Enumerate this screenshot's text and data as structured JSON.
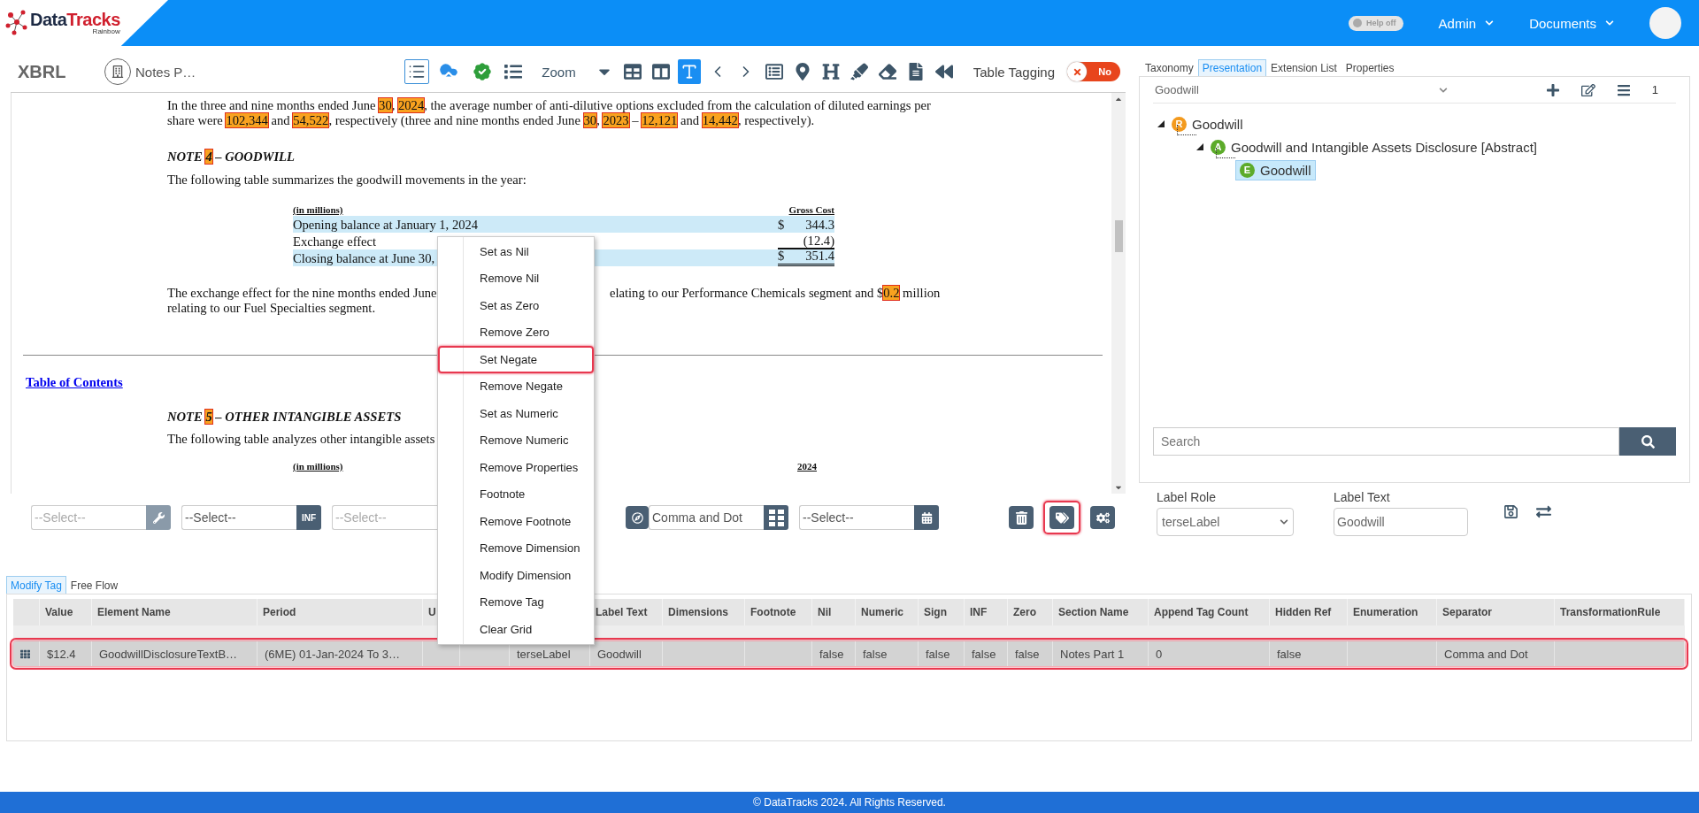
{
  "header": {
    "logo": {
      "brand_first": "Data",
      "brand_second": "Tracks",
      "tagline": "Rainbow"
    },
    "help_toggle": {
      "label": "Help off",
      "on": false
    },
    "menus": [
      {
        "label": "Admin"
      },
      {
        "label": "Documents"
      }
    ]
  },
  "toolbar": {
    "title": "XBRL",
    "section": "Notes P…",
    "tools": [
      {
        "kind": "panel",
        "selected": false
      },
      {
        "kind": "upload",
        "selected": false
      },
      {
        "kind": "verify",
        "selected": false
      },
      {
        "kind": "list",
        "selected": false
      },
      {
        "kind": "zoom",
        "label": "Zoom",
        "selected": false
      },
      {
        "kind": "caret",
        "selected": false
      },
      {
        "kind": "table",
        "selected": false
      },
      {
        "kind": "columns",
        "selected": false
      },
      {
        "kind": "text",
        "selected": true
      },
      {
        "kind": "prev",
        "selected": false
      },
      {
        "kind": "next",
        "selected": false
      },
      {
        "kind": "card",
        "selected": false
      },
      {
        "kind": "pin",
        "selected": false
      },
      {
        "kind": "heading",
        "selected": false
      },
      {
        "kind": "highlight",
        "selected": false
      },
      {
        "kind": "erase",
        "selected": false
      },
      {
        "kind": "file",
        "selected": false
      },
      {
        "kind": "back",
        "selected": false
      }
    ],
    "table_tagging": {
      "label": "Table Tagging",
      "toggle_label": "No",
      "on": false
    }
  },
  "document": {
    "paragraph_1": [
      {
        "text": "In the three and nine months ended June ",
        "tagged": false
      },
      {
        "text": "30",
        "tagged": true
      },
      {
        "text": ", ",
        "tagged": false
      },
      {
        "text": "2024",
        "tagged": true
      },
      {
        "text": ", the average number of anti-dilutive options excluded from the calculation of diluted earnings per share were ",
        "tagged": false
      },
      {
        "text": "102,344",
        "tagged": true
      },
      {
        "text": " and ",
        "tagged": false
      },
      {
        "text": "54,522",
        "tagged": true
      },
      {
        "text": ", respectively (three and nine months ended June ",
        "tagged": false
      },
      {
        "text": "30",
        "tagged": true
      },
      {
        "text": ", ",
        "tagged": false
      },
      {
        "text": "2023",
        "tagged": true
      },
      {
        "text": " – ",
        "tagged": false
      },
      {
        "text": "12,121",
        "tagged": true
      },
      {
        "text": " and ",
        "tagged": false
      },
      {
        "text": "14,442",
        "tagged": true
      },
      {
        "text": ", respectively).",
        "tagged": false
      }
    ],
    "note_4_heading": [
      {
        "text": "NOTE ",
        "tagged": false
      },
      {
        "text": "4",
        "tagged": true
      },
      {
        "text": " – GOODWILL",
        "tagged": false
      }
    ],
    "note_4_intro": "The following table summarizes the goodwill movements in the year:",
    "goodwill_table": {
      "unit_header": "(in millions)",
      "value_header": "Gross Cost",
      "rows": [
        {
          "label": "Opening balance at January 1, 2024",
          "currency": "$",
          "value": "344.3",
          "shaded": true,
          "kind": "plain"
        },
        {
          "label": "Exchange effect",
          "value": "(12.4)",
          "shaded": false,
          "kind": "subtotal"
        },
        {
          "label": "Closing balance at June 30,",
          "currency": "$",
          "value": "351.4",
          "shaded": true,
          "kind": "total"
        }
      ]
    },
    "exchange_paragraph": {
      "left": "The exchange effect for the nine months ended June",
      "right": [
        {
          "text": "elating to our Performance Chemicals segment and $",
          "tagged": false
        },
        {
          "text": "0.2",
          "tagged": true
        },
        {
          "text": " million",
          "tagged": false
        }
      ],
      "continuation": "relating to our Fuel Specialties segment."
    },
    "toc_link": "Table of Contents",
    "note_5_heading": [
      {
        "text": "NOTE ",
        "tagged": false
      },
      {
        "text": "5",
        "tagged": true
      },
      {
        "text": " – OTHER INTANGIBLE ASSETS",
        "tagged": false
      }
    ],
    "note_5_intro": "The following table analyzes other intangible assets",
    "next_table": {
      "unit_header": "(in millions)",
      "value_header": "2024"
    }
  },
  "context_menu": {
    "items": [
      {
        "label": "Set as Nil",
        "highlighted": false
      },
      {
        "label": "Remove Nil",
        "highlighted": false
      },
      {
        "label": "Set as Zero",
        "highlighted": false
      },
      {
        "label": "Remove Zero",
        "highlighted": false
      },
      {
        "label": "Set Negate",
        "highlighted": true
      },
      {
        "label": "Remove Negate",
        "highlighted": false
      },
      {
        "label": "Set as Numeric",
        "highlighted": false
      },
      {
        "label": "Remove Numeric",
        "highlighted": false
      },
      {
        "label": "Remove Properties",
        "highlighted": false
      },
      {
        "label": "Footnote",
        "highlighted": false
      },
      {
        "label": "Remove Footnote",
        "highlighted": false
      },
      {
        "label": "Remove Dimension",
        "highlighted": false
      },
      {
        "label": "Modify Dimension",
        "highlighted": false
      },
      {
        "label": "Remove Tag",
        "highlighted": false
      },
      {
        "label": "Clear Grid",
        "highlighted": false
      }
    ]
  },
  "controls": {
    "fields": [
      {
        "placeholder": "--Select--",
        "disabled": true,
        "button": {
          "kind": "wrench"
        }
      },
      {
        "placeholder": "--Select--",
        "disabled": false,
        "button": {
          "kind": "inf",
          "label": "INF"
        }
      },
      {
        "placeholder": "--Select--",
        "disabled": true,
        "button": {
          "kind": "compass"
        }
      },
      {
        "value": "Comma and Dot",
        "disabled": false,
        "button": {
          "kind": "grid"
        }
      },
      {
        "placeholder": "--Select--",
        "disabled": false,
        "button": {
          "kind": "calendar"
        }
      }
    ],
    "actions": [
      {
        "kind": "delete",
        "highlighted": false
      },
      {
        "kind": "tag",
        "highlighted": true
      },
      {
        "kind": "settings",
        "highlighted": false
      }
    ]
  },
  "right_panel": {
    "tabs": [
      {
        "label": "Taxonomy",
        "selected": false
      },
      {
        "label": "Presentation",
        "selected": true
      },
      {
        "label": "Extension List",
        "selected": false
      },
      {
        "label": "Properties",
        "selected": false
      }
    ],
    "dropdown": "Goodwill",
    "count": "1",
    "tree": [
      {
        "badge": "R",
        "label": "Goodwill",
        "color": "#f39a1e",
        "selected": false,
        "children": [
          {
            "badge": "A",
            "label": "Goodwill and Intangible Assets Disclosure [Abstract]",
            "color": "#5cab2a",
            "selected": false,
            "children": [
              {
                "badge": "E",
                "label": "Goodwill",
                "color": "#5cab2a",
                "selected": true
              }
            ]
          }
        ]
      }
    ],
    "search_placeholder": "Search",
    "label_role": {
      "label": "Label Role",
      "value": "terseLabel"
    },
    "label_text": {
      "label": "Label Text",
      "value": "Goodwill"
    }
  },
  "bottom_tabs": [
    {
      "label": "Modify Tag",
      "selected": true
    },
    {
      "label": "Free Flow",
      "selected": false
    }
  ],
  "grid": {
    "columns": [
      "Value",
      "Element Name",
      "Period",
      "U",
      null,
      null,
      "Label Text",
      "Dimensions",
      "Footnote",
      "Nil",
      "Numeric",
      "Sign",
      "INF",
      "Zero",
      "Section Name",
      "Append Tag Count",
      "Hidden Ref",
      "Enumeration",
      "Separator",
      "TransformationRule"
    ],
    "rows": [
      {
        "selected": true,
        "cells": [
          "$12.4",
          "GoodwillDisclosureTextB…",
          "(6ME) 01-Jan-2024 To 3…",
          null,
          null,
          "terseLabel",
          "Goodwill",
          null,
          null,
          "false",
          "false",
          "false",
          "false",
          "false",
          "Notes Part 1",
          "0",
          "false",
          null,
          "Comma and Dot",
          null
        ]
      }
    ]
  },
  "footer": "© DataTracks 2024. All Rights Reserved."
}
